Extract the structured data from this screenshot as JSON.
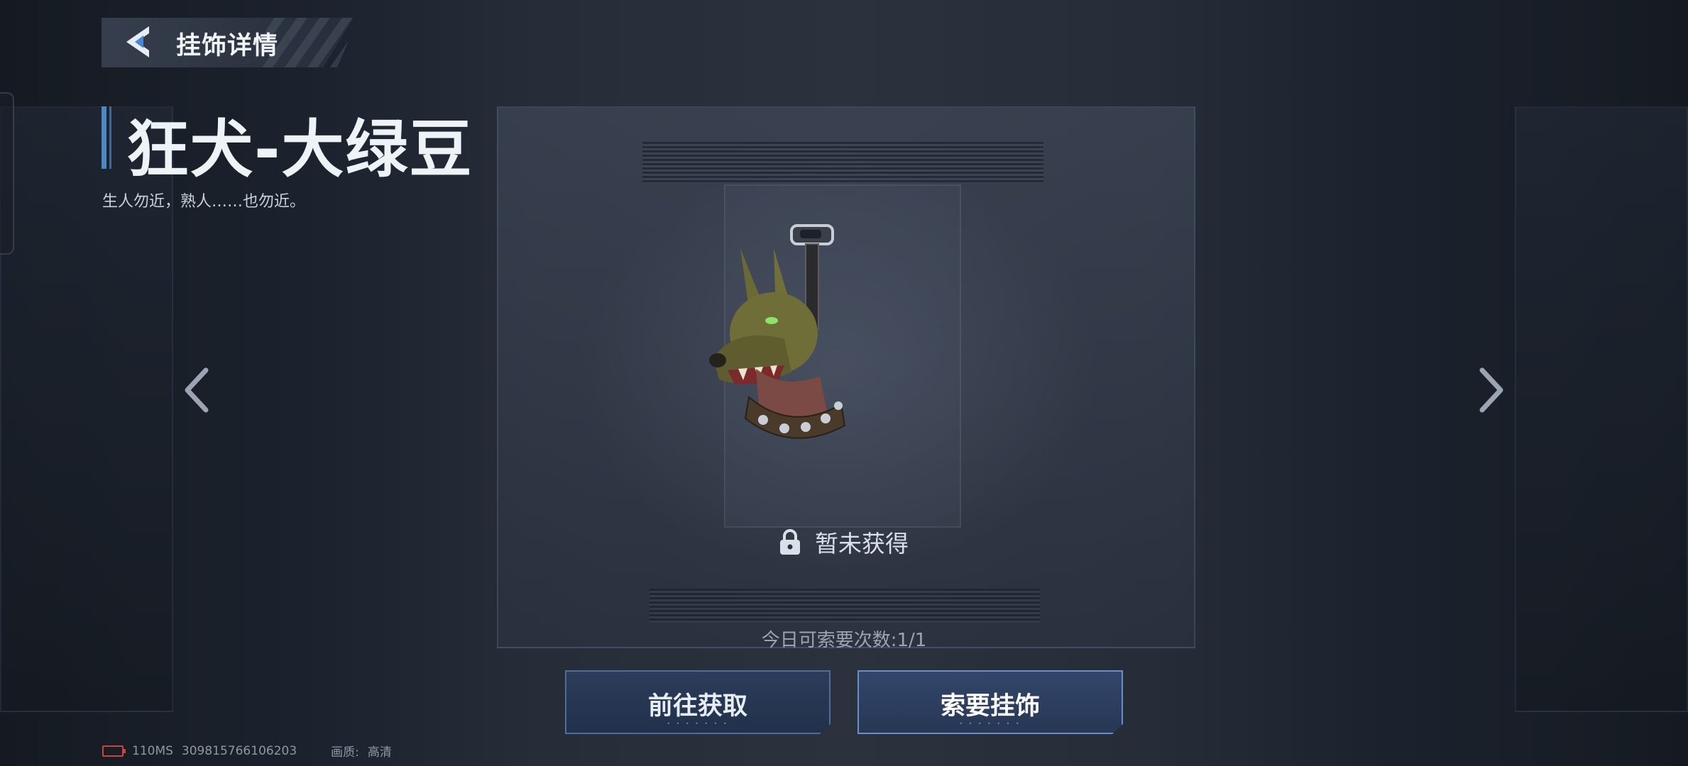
{
  "header": {
    "title": "挂饰详情"
  },
  "item": {
    "name": "狂犬-大绿豆",
    "description": "生人勿近，熟人……也勿近。",
    "status": "暂未获得"
  },
  "request_count": "今日可索要次数:1/1",
  "buttons": {
    "go_obtain": "前往获取",
    "request": "索要挂饰"
  },
  "footer": {
    "ping": "110MS",
    "uid": "309815766106203",
    "quality_label": "画质:",
    "quality_value": "高清"
  },
  "colors": {
    "accent": "#4c88c4",
    "button_border": "#4f6d9a",
    "battery": "#c8473d"
  },
  "icons": {
    "back": "back-chevron-icon",
    "lock": "lock-icon",
    "prev": "chevron-left-icon",
    "next": "chevron-right-icon",
    "battery": "battery-low-icon"
  }
}
